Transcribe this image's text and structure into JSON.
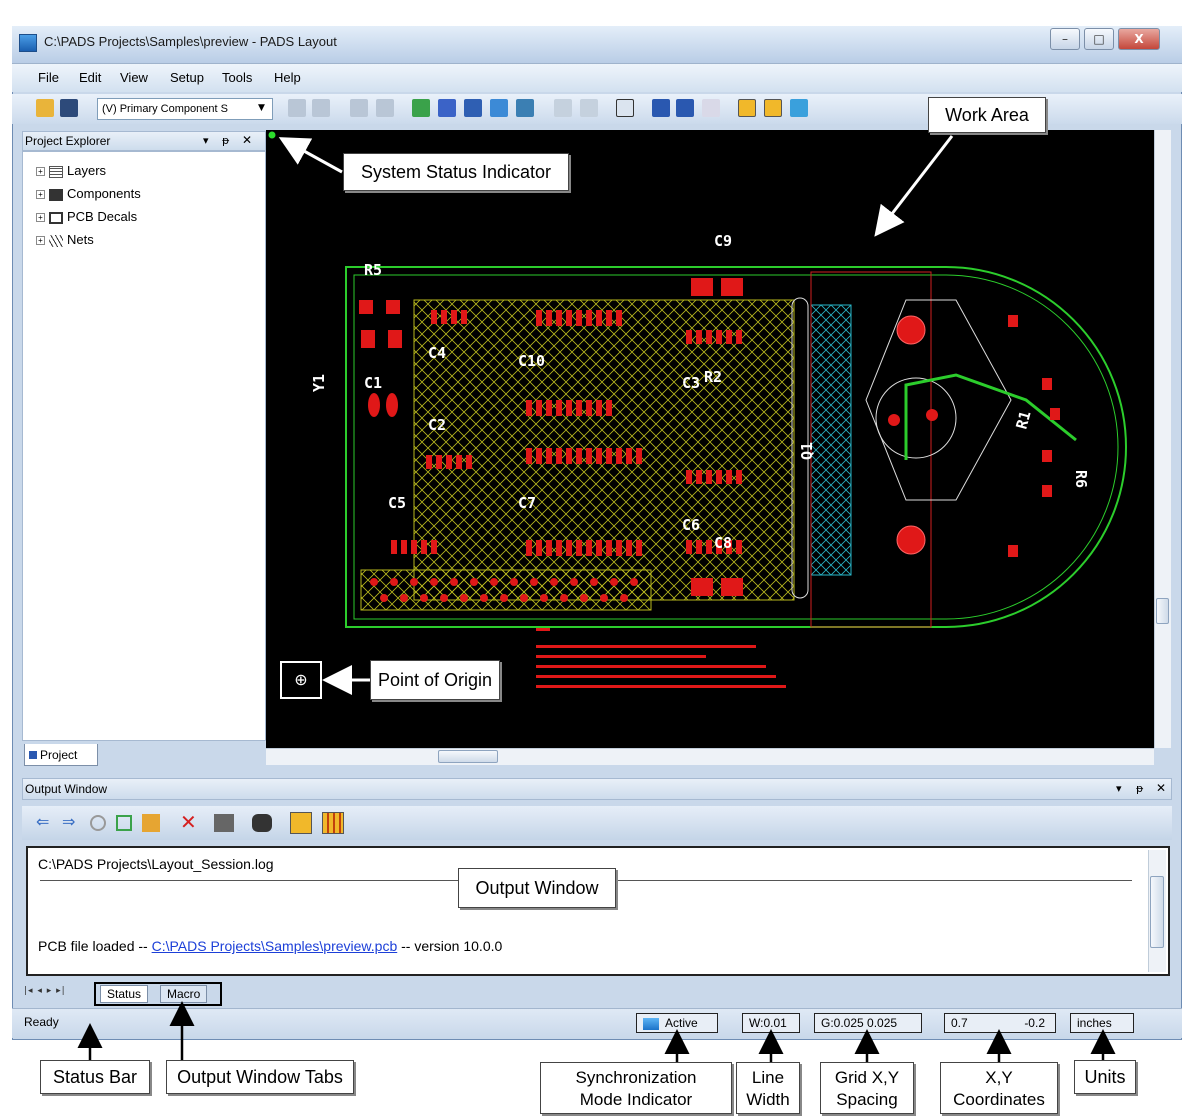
{
  "window": {
    "title": "C:\\PADS Projects\\Samples\\preview - PADS Layout",
    "minimize_glyph": "–",
    "maximize_glyph": "□",
    "close_glyph": "X"
  },
  "menu": [
    "File",
    "Edit",
    "View",
    "Setup",
    "Tools",
    "Help"
  ],
  "toolbar": {
    "layer_select": "(V) Primary Component S",
    "icons": [
      "open-icon",
      "save-icon",
      "properties-icon",
      "refresh-icon",
      "copy-icon",
      "paste-icon",
      "route-icon",
      "component-icon",
      "decal-icon",
      "trace-icon",
      "bug-icon",
      "undo-icon",
      "redo-icon",
      "zoom-icon",
      "funnel-icon",
      "filter-icon",
      "check-icon",
      "highlight-icon",
      "window-icon",
      "sync-icon"
    ]
  },
  "project_explorer": {
    "title": "Project Explorer",
    "controls": [
      "▾",
      "ᵽ",
      "✕"
    ],
    "tree": [
      {
        "label": "Layers",
        "icon": "layers-icon"
      },
      {
        "label": "Components",
        "icon": "components-icon"
      },
      {
        "label": "PCB Decals",
        "icon": "pcb-decals-icon"
      },
      {
        "label": "Nets",
        "icon": "nets-icon"
      }
    ],
    "tab": "Project"
  },
  "work_area": {
    "status_indicator_color": "#2cdc2c",
    "board_outline_color": "#2ccd2c",
    "labels": [
      "C9",
      "R5",
      "Y1",
      "C1",
      "C4",
      "C10",
      "C2",
      "C3",
      "R2",
      "Q1",
      "R1",
      "R6",
      "C5",
      "C7",
      "C6",
      "C8"
    ],
    "origin_glyph": "⊕"
  },
  "output_window": {
    "title": "Output Window",
    "controls": [
      "▾",
      "ᵽ",
      "✕"
    ],
    "log_file": "C:\\PADS Projects\\Layout_Session.log",
    "message_prefix": "PCB file loaded -- ",
    "message_link": "C:\\PADS Projects\\Samples\\preview.pcb",
    "message_suffix": " -- version 10.0.0",
    "tab_nav": "|◂ ◂ ▸ ▸|",
    "tabs": [
      "Status",
      "Macro"
    ]
  },
  "status_bar": {
    "ready": "Ready",
    "sync": "Active",
    "line_width": "W:0.01",
    "grid": "G:0.025 0.025",
    "x": "0.7",
    "y": "-0.2",
    "units": "inches"
  },
  "callouts": {
    "work_area": "Work Area",
    "system_status": "System Status Indicator",
    "point_of_origin": "Point of Origin",
    "output_window": "Output Window",
    "status_bar": "Status Bar",
    "output_tabs": "Output Window Tabs",
    "sync_mode_1": "Synchronization",
    "sync_mode_2": "Mode Indicator",
    "line_width_1": "Line",
    "line_width_2": "Width",
    "grid_1": "Grid X,Y",
    "grid_2": "Spacing",
    "xy_1": "X,Y",
    "xy_2": "Coordinates",
    "units": "Units"
  }
}
